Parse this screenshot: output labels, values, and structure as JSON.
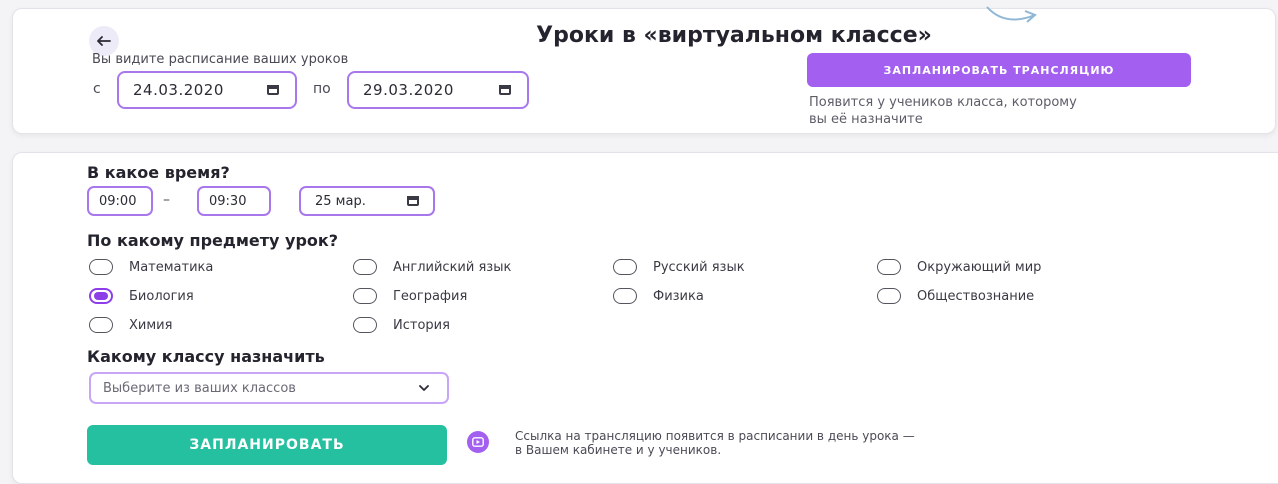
{
  "header": {
    "title": "Уроки в «виртуальном классе»",
    "subtitle": "Вы видите расписание ваших уроков",
    "from_label": "с",
    "to_label": "по",
    "date_from": "24.03.2020",
    "date_to": "29.03.2020",
    "schedule_broadcast_label": "ЗАПЛАНИРОВАТЬ ТРАНСЛЯЦИЮ",
    "note_line1": "Появится у учеников класса, которому",
    "note_line2": "вы её назначите"
  },
  "form": {
    "time_title": "В какое время?",
    "time_start": "09:00",
    "time_separator": "–",
    "time_end": "09:30",
    "date": "25 мар.",
    "subject_title": "По какому предмету урок?",
    "subjects": [
      {
        "label": "Математика",
        "selected": false
      },
      {
        "label": "Английский язык",
        "selected": false
      },
      {
        "label": "Русский язык",
        "selected": false
      },
      {
        "label": "Окружающий мир",
        "selected": false
      },
      {
        "label": "Биология",
        "selected": true
      },
      {
        "label": "География",
        "selected": false
      },
      {
        "label": "Физика",
        "selected": false
      },
      {
        "label": "Обществознание",
        "selected": false
      },
      {
        "label": "Химия",
        "selected": false
      },
      {
        "label": "История",
        "selected": false
      }
    ],
    "class_title": "Какому классу назначить",
    "class_placeholder": "Выберите из ваших классов",
    "submit_label": "ЗАПЛАНИРОВАТЬ",
    "info_line1": "Ссылка на трансляцию появится в расписании в день урока —",
    "info_line2": "в Вашем кабинете и у учеников."
  },
  "colors": {
    "accent": "#a35ff0",
    "submit": "#25c0a0",
    "field_border": "#a877ec"
  },
  "icons": [
    "arrow-left-icon",
    "calendar-icon",
    "chevron-down-icon",
    "video-play-icon",
    "curved-arrow-icon"
  ]
}
